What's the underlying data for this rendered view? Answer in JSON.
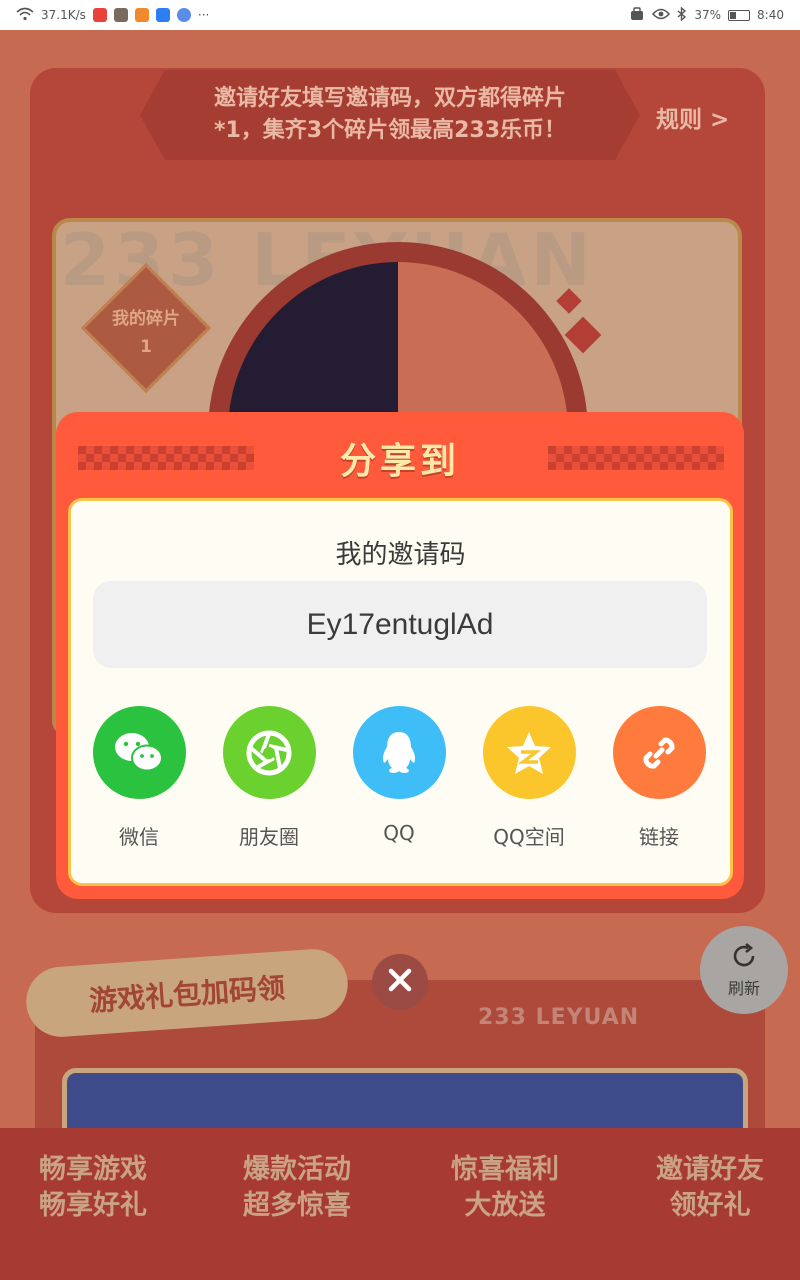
{
  "status_bar": {
    "network_speed": "37.1K/s",
    "battery": "37%",
    "time": "8:40"
  },
  "background": {
    "banner_text_line1": "邀请好友填写邀请码，双方都得碎片",
    "banner_text_line2": "*1，集齐3个碎片领最高233乐币！",
    "rules_link": "规则 >",
    "watermark": "233 LEYUAN",
    "fragment_label": "我的碎片",
    "fragment_count": "1",
    "gift_section_title": "游戏礼包加码领",
    "leyuan_text": "233 LEYUAN",
    "promos": [
      {
        "line1": "畅享游戏",
        "line2": "畅享好礼"
      },
      {
        "line1": "爆款活动",
        "line2": "超多惊喜"
      },
      {
        "line1": "惊喜福利",
        "line2": "大放送"
      },
      {
        "line1": "邀请好友",
        "line2": "领好礼"
      }
    ]
  },
  "refresh_button": {
    "label": "刷新"
  },
  "dialog": {
    "title": "分享到",
    "code_label": "我的邀请码",
    "invite_code": "Ey17entuglAd",
    "share_targets": [
      {
        "label": "微信",
        "icon": "wechat-icon",
        "color": "#2bc23f"
      },
      {
        "label": "朋友圈",
        "icon": "moments-icon",
        "color": "#6ad12f"
      },
      {
        "label": "QQ",
        "icon": "qq-icon",
        "color": "#3ebdf6"
      },
      {
        "label": "QQ空间",
        "icon": "qzone-icon",
        "color": "#fbc62b"
      },
      {
        "label": "链接",
        "icon": "link-icon",
        "color": "#ff7a3d"
      }
    ]
  },
  "colors": {
    "dialog_red": "#ff5a3c",
    "panel_bg": "#fffdf3",
    "title_yellow": "#ffe9a8"
  }
}
